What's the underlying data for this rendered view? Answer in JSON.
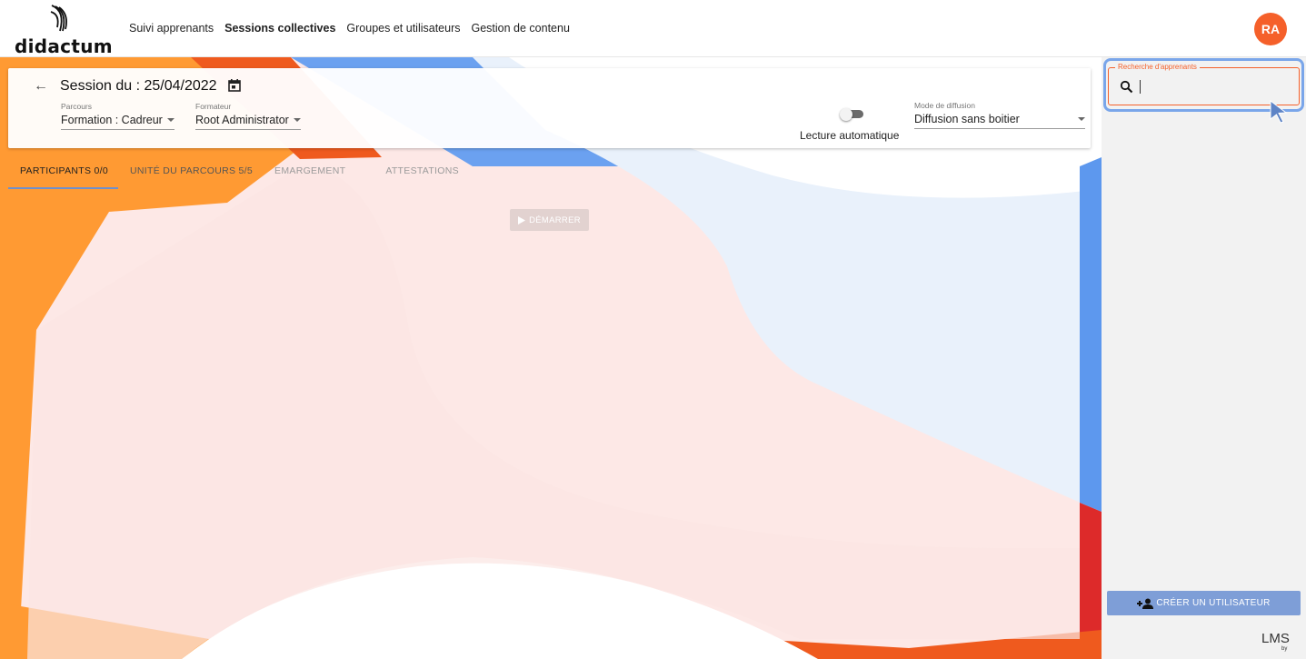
{
  "brand": {
    "name": "didactum"
  },
  "nav": {
    "items": [
      "Suivi apprenants",
      "Sessions collectives",
      "Groupes et utilisateurs",
      "Gestion de contenu"
    ]
  },
  "user": {
    "initials": "RA"
  },
  "session": {
    "title": "Session du : 25/04/2022",
    "parcours_label": "Parcours",
    "parcours_value": "Formation : Cadreur",
    "formateur_label": "Formateur",
    "formateur_value": "Root Administrator",
    "autoplay_label": "Lecture automatique",
    "mode_label": "Mode de diffusion",
    "mode_value": "Diffusion sans boitier"
  },
  "tabs": [
    "PARTICIPANTS 0/0",
    "UNITÉ DU PARCOURS 5/5",
    "EMARGEMENT",
    "ATTESTATIONS"
  ],
  "start_button": "DÉMARRER",
  "search": {
    "label": "Recherche d'apprenants",
    "value": ""
  },
  "create_user_button": "CRÉER UN UTILISATEUR",
  "footer": {
    "lms": "LMS",
    "by": "by"
  },
  "colors": {
    "accent": "#f5602a",
    "primary_blue": "#7e9ed7",
    "focus_ring": "#7aa6ea",
    "deco_orange": "#ff9a33",
    "deco_red": "#dd2a2a",
    "deco_blue": "#6ba1f0"
  }
}
